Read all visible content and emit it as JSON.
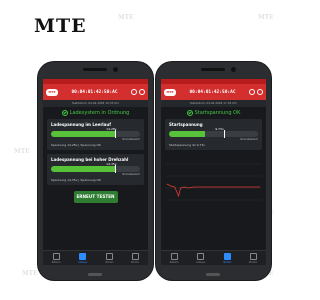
{
  "logo": "MTE",
  "watermark": "MTE",
  "phones": [
    {
      "status_left": "",
      "status_right": "",
      "header_title": "00:04:01:42:50:AC",
      "header_sub": "Testdatum: 04.02.2018 10:33 Uhr",
      "status_message": "Ladesystem in Ordnung",
      "cards": [
        {
          "title": "Ladespannung im Leerlauf",
          "value": "14.28v",
          "scale_left": "",
          "scale_right": "Normalbereich",
          "fill": 0.72,
          "info": "Spannung 14,28v  |  Spannung OK"
        },
        {
          "title": "Ladespannung bei hoher Drehzahl",
          "value": "14.35v",
          "scale_left": "",
          "scale_right": "Normalbereich",
          "fill": 0.72,
          "info": "Spannung 14,35v  |  Spannung OK"
        }
      ],
      "button": "ERNEUT TESTEN",
      "nav": [
        "Batterie",
        "Ladesys.",
        "Starten",
        "Monitor"
      ]
    },
    {
      "status_left": "",
      "status_right": "",
      "header_title": "00:04:01:42:50:AC",
      "header_sub": "Testdatum: 04.02.2018 17:34 Uhr",
      "status_message": "Startspannung OK",
      "cards": [
        {
          "title": "Startspannung",
          "value": "9.73v",
          "scale_left": "",
          "scale_right": "Normalbereich",
          "fill": 0.4,
          "info": "Startspannung ist 9,73v"
        }
      ],
      "nav": [
        "Batterie",
        "Ladesys.",
        "Starten",
        "Monitor"
      ]
    }
  ],
  "colors": {
    "header": "#d32f2f",
    "ok": "#43c943",
    "bar": "#58c13a",
    "button": "#2e7d32",
    "active_nav": "#2f8cff"
  }
}
